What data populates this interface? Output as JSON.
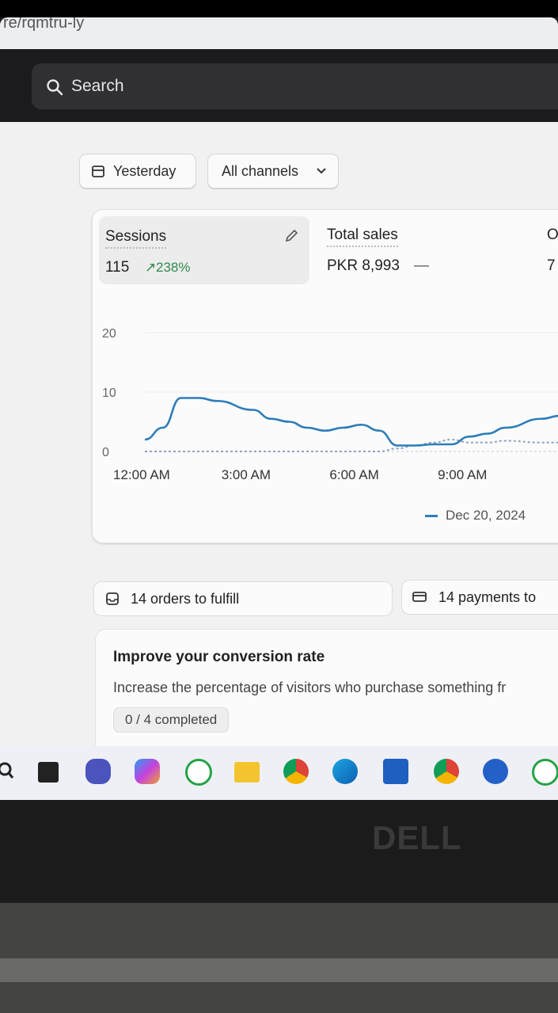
{
  "browser": {
    "url_fragment": "re/rqmtru-ly"
  },
  "search": {
    "placeholder": "Search",
    "icon": "search-icon"
  },
  "filters": {
    "date_range": "Yesterday",
    "channels": "All channels"
  },
  "metrics": [
    {
      "title": "Sessions",
      "value": "115",
      "change": "238%",
      "selected": true
    },
    {
      "title": "Total sales",
      "value": "PKR 8,993",
      "change": "—"
    },
    {
      "title": "O",
      "value": "7"
    }
  ],
  "chart_data": {
    "type": "line",
    "metric": "Sessions",
    "x_ticks": [
      "12:00 AM",
      "3:00 AM",
      "6:00 AM",
      "9:00 AM"
    ],
    "y_ticks": [
      0,
      10,
      20
    ],
    "ylim": [
      0,
      20
    ],
    "grid": true,
    "series": [
      {
        "name": "Dec 20, 2024",
        "color": "#2d7db8",
        "hours": [
          0,
          0.5,
          1,
          1.5,
          2,
          3,
          3.5,
          4,
          4.5,
          5,
          5.5,
          6,
          6.5,
          7,
          7.5,
          8,
          8.5,
          9,
          9.5,
          10,
          11,
          11.5
        ],
        "values": [
          2,
          4,
          9,
          9,
          8.5,
          7,
          5.5,
          5,
          4,
          3.5,
          4,
          4.5,
          3.5,
          1,
          1,
          1.2,
          1.2,
          2.5,
          3,
          4,
          5.5,
          6
        ]
      },
      {
        "name": "",
        "color": "#8aa2c5",
        "dashed": true,
        "hours": [
          0,
          1,
          2,
          3,
          4,
          5,
          6,
          6.5,
          7,
          7.5,
          8,
          8.5,
          9,
          9.5,
          10,
          11,
          11.5
        ],
        "values": [
          0,
          0,
          0,
          0,
          0,
          0,
          0,
          0,
          0.5,
          1,
          1.5,
          2,
          1.5,
          1.5,
          1.8,
          1.5,
          1.5
        ]
      }
    ],
    "legend": [
      "Dec 20, 2024"
    ],
    "legend_position": "bottom-right"
  },
  "tasks": [
    {
      "label": "14 orders to fulfill",
      "icon": "inbox-icon"
    },
    {
      "label": "14 payments to",
      "icon": "card-icon"
    }
  ],
  "setup_card": {
    "title": "Improve your conversion rate",
    "description": "Increase the percentage of visitors who purchase something fr",
    "progress": "0 / 4 completed"
  },
  "taskbar": {
    "icons": [
      "windows-search-icon",
      "task-view-icon",
      "teams-icon",
      "copilot-icon",
      "whatsapp-icon",
      "file-explorer-icon",
      "chrome-icon",
      "edge-icon",
      "store-icon",
      "chrome-icon-2",
      "app-icon",
      "whatsapp-icon-2"
    ]
  },
  "device": {
    "brand": "DELL"
  }
}
